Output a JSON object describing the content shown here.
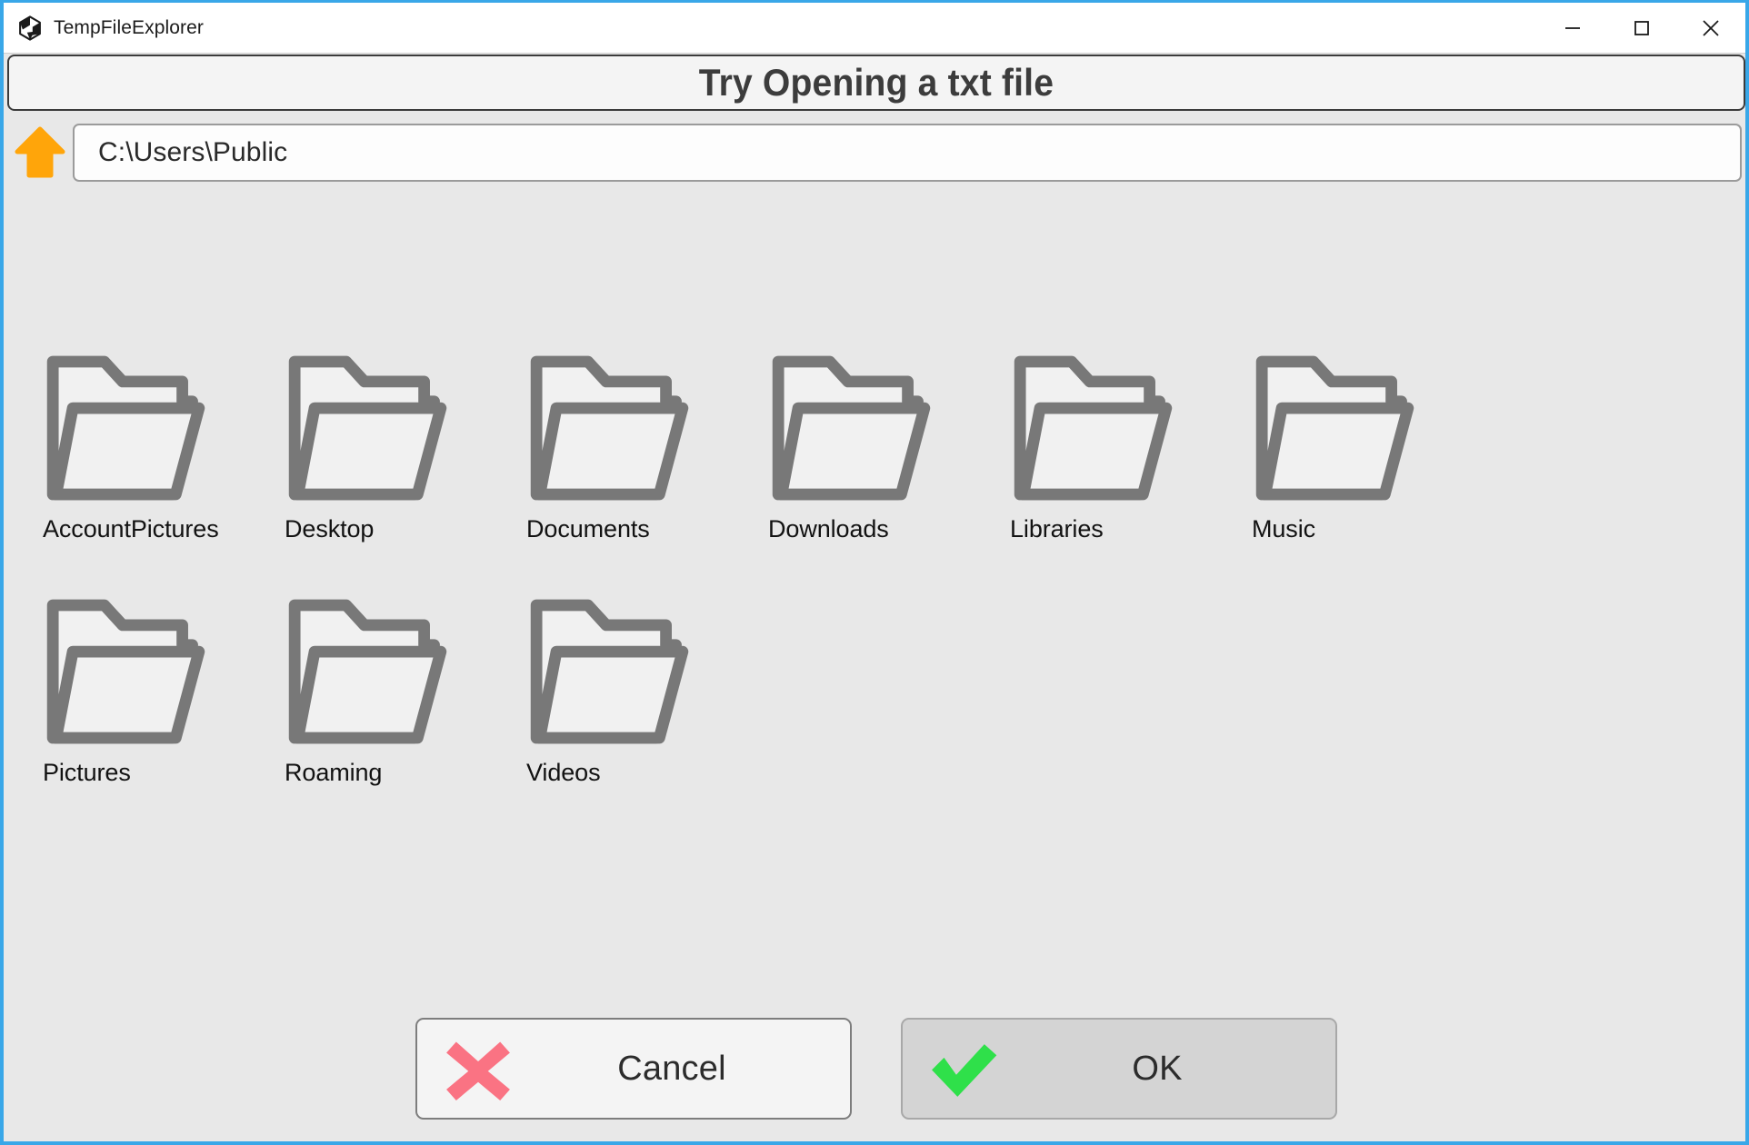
{
  "window": {
    "app_title": "TempFileExplorer",
    "logo_icon": "unity-logo-icon",
    "border_color": "#39a7e8",
    "controls": {
      "minimize": "minimize-icon",
      "maximize": "maximize-icon",
      "close": "close-icon"
    }
  },
  "banner": {
    "title": "Try Opening a txt file",
    "background": "#f4f4f4",
    "text_color": "#3c3c3c"
  },
  "pathbar": {
    "up_icon": "arrow-up-icon",
    "up_icon_color": "#ffa50a",
    "path_value": "C:\\Users\\Public",
    "path_placeholder": "Path"
  },
  "files": {
    "background": "#e8e8e8",
    "folder_stroke": "#787878",
    "folder_fill": "#f1f1f1",
    "items": [
      {
        "name": "AccountPictures",
        "icon": "folder-icon",
        "type": "folder"
      },
      {
        "name": "Desktop",
        "icon": "folder-icon",
        "type": "folder"
      },
      {
        "name": "Documents",
        "icon": "folder-icon",
        "type": "folder"
      },
      {
        "name": "Downloads",
        "icon": "folder-icon",
        "type": "folder"
      },
      {
        "name": "Libraries",
        "icon": "folder-icon",
        "type": "folder"
      },
      {
        "name": "Music",
        "icon": "folder-icon",
        "type": "folder"
      },
      {
        "name": "Pictures",
        "icon": "folder-icon",
        "type": "folder"
      },
      {
        "name": "Roaming",
        "icon": "folder-icon",
        "type": "folder"
      },
      {
        "name": "Videos",
        "icon": "folder-icon",
        "type": "folder"
      }
    ]
  },
  "footer": {
    "cancel": {
      "label": "Cancel",
      "icon": "cross-icon",
      "icon_color": "#fa7383",
      "background": "#f4f4f4"
    },
    "ok": {
      "label": "OK",
      "icon": "check-icon",
      "icon_color": "#2fe04a",
      "background": "#d4d4d4"
    }
  }
}
